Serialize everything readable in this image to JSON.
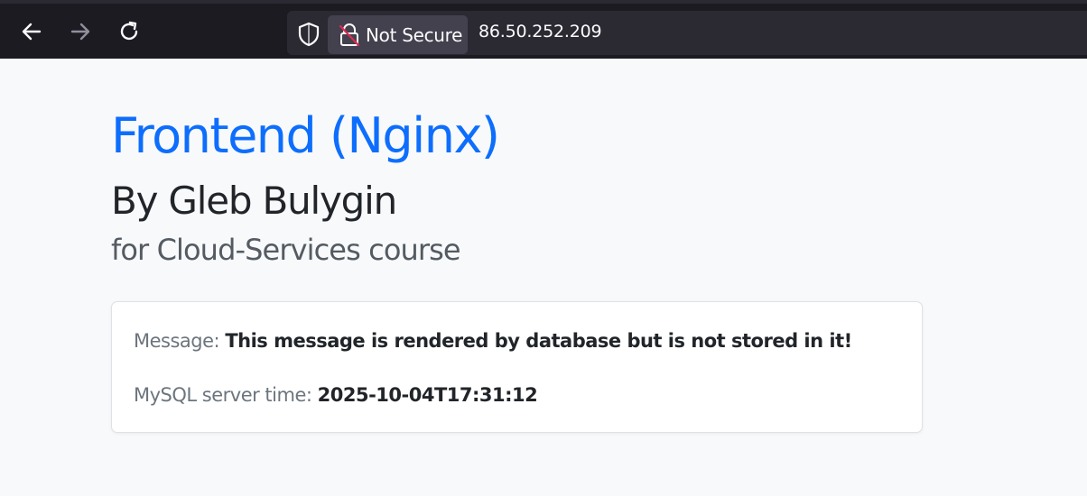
{
  "browser": {
    "back_icon": "arrow-left-icon",
    "forward_icon": "arrow-right-icon",
    "reload_icon": "reload-icon",
    "shield_icon": "shield-icon",
    "lock_icon": "insecure-lock-icon",
    "security_label": "Not Secure",
    "url": "86.50.252.209"
  },
  "page": {
    "title": "Frontend (Nginx)",
    "subtitle": "By Gleb Bulygin",
    "course": "for Cloud-Services course",
    "card": {
      "message_label": "Message:",
      "message_value": "This message is rendered by database but is not stored in it!",
      "time_label": "MySQL server time:",
      "time_value": "2025-10-04T17:31:12"
    }
  },
  "colors": {
    "accent": "#0d6efd",
    "toolbar": "#1c1b22",
    "page_bg": "#f8f9fa"
  }
}
